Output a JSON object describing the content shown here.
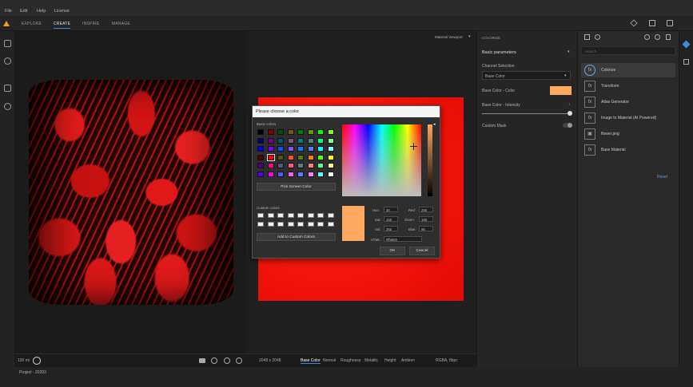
{
  "menu": [
    "File",
    "Edit",
    "Help",
    "License"
  ],
  "tabs": [
    {
      "label": "EXPLORE",
      "active": false
    },
    {
      "label": "CREATE",
      "active": true
    },
    {
      "label": "INSPIRE",
      "active": false
    },
    {
      "label": "MANAGE",
      "active": false
    }
  ],
  "viewport": {
    "material_dropdown": "Material Viewport",
    "zoom_label": "100 mi",
    "resolution": "2048 x 2048",
    "channels": [
      "Base Color",
      "Normal",
      "Roughness",
      "Metallic",
      "Height",
      "Ambien"
    ],
    "active_channel": "Base Color",
    "format": "RGBA, 8bpc"
  },
  "status": {
    "project": "Project - 20203"
  },
  "colorize_panel": {
    "header": "COLORIZE",
    "section": "Basic parameters",
    "channel_label": "Channel Selection",
    "channel_value": "Base Color",
    "base_color_label": "Base Color - Color",
    "base_color_hex": "#ffa860",
    "intensity_label": "Base Color - Intensity",
    "custom_mask_label": "Custom Mask"
  },
  "layers": {
    "search_placeholder": "Search",
    "items": [
      {
        "name": "Colorize",
        "selected": true
      },
      {
        "name": "Transform",
        "selected": false
      },
      {
        "name": "Atlas Generator",
        "selected": false
      },
      {
        "name": "Image to Material (AI Powered)",
        "selected": false
      },
      {
        "name": "flower.png",
        "selected": false
      },
      {
        "name": "Base Material",
        "selected": false
      }
    ],
    "reset_label": "Reset"
  },
  "dialog": {
    "title": "Please choose a color",
    "basic_colors_label": "Basic colors",
    "pick_screen_label": "Pick Screen Color",
    "custom_colors_label": "Custom colors",
    "add_custom_label": "Add to Custom Colors",
    "hue_label": "Hue:",
    "hue": "30",
    "sat_label": "Sat:",
    "sat": "158",
    "val_label": "Val:",
    "val": "255",
    "red_label": "Red:",
    "red": "255",
    "green_label": "Green:",
    "green": "168",
    "blue_label": "Blue:",
    "blue": "96",
    "html_label": "HTML:",
    "html": "#ffa860",
    "ok_label": "OK",
    "cancel_label": "Cancel",
    "current_color": "#ffa860",
    "basic_colors": [
      "#000000",
      "#800000",
      "#005500",
      "#805500",
      "#008000",
      "#55a000",
      "#00ff00",
      "#80ff00",
      "#00007f",
      "#7f007f",
      "#00557f",
      "#7f557f",
      "#007f7f",
      "#557f7f",
      "#00ff7f",
      "#7fff7f",
      "#0000ff",
      "#7f00ff",
      "#0055ff",
      "#7f55ff",
      "#007fff",
      "#557fff",
      "#00ffff",
      "#7fffff",
      "#550000",
      "#ff0000",
      "#555500",
      "#ff5500",
      "#557f00",
      "#ff7f00",
      "#55ff00",
      "#ffff00",
      "#55007f",
      "#ff007f",
      "#55557f",
      "#ff557f",
      "#557f7f",
      "#ff7f7f",
      "#55ff7f",
      "#ffff7f",
      "#5500ff",
      "#ff00ff",
      "#5555ff",
      "#ff55ff",
      "#557fff",
      "#ff7fff",
      "#55ffff",
      "#ffffff"
    ]
  }
}
